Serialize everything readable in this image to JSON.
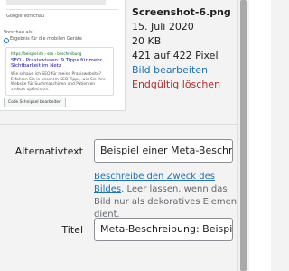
{
  "preview": {
    "google_title": "Google Vorschau",
    "preview_label": "Vorschau als:",
    "device_label": "Ergebnis für die mobilen Geräte",
    "snippet_url": "https://beispiel.de › seo › beschreibung",
    "snippet_title": "SEO - Praxiswissen: 9 Tipps für mehr Sichtbarkeit im Netz",
    "snippet_desc": "Wie schaue ich SEO für meine Praxiswebsite? Erfahren Sie in unserem SEO-Tipps, wie Sie Ihre Website für Suchmaschinen und Patienten einfach optimieren.",
    "snippet_button": "Code Schnipsel bearbeiten"
  },
  "attachment": {
    "filename": "Screenshot-6.png",
    "date": "15. Juli 2020",
    "size": "20 KB",
    "dimensions": "421 auf 422 Pixel",
    "edit_link": "Bild bearbeiten",
    "delete_link": "Endgültig löschen"
  },
  "fields": {
    "alt_label": "Alternativtext",
    "alt_value": "Beispiel einer Meta-Beschreibung",
    "alt_help_link": "Beschreibe den Zweck des Bildes",
    "alt_help_text": ". Leer lassen, wenn das Bild nur als dekoratives Element dient.",
    "title_label": "Titel",
    "title_value": "Meta-Beschreibung: Beispiel"
  },
  "colors": {
    "link": "#2271b1",
    "danger": "#b32d2e",
    "background": "#f3f3f3"
  }
}
